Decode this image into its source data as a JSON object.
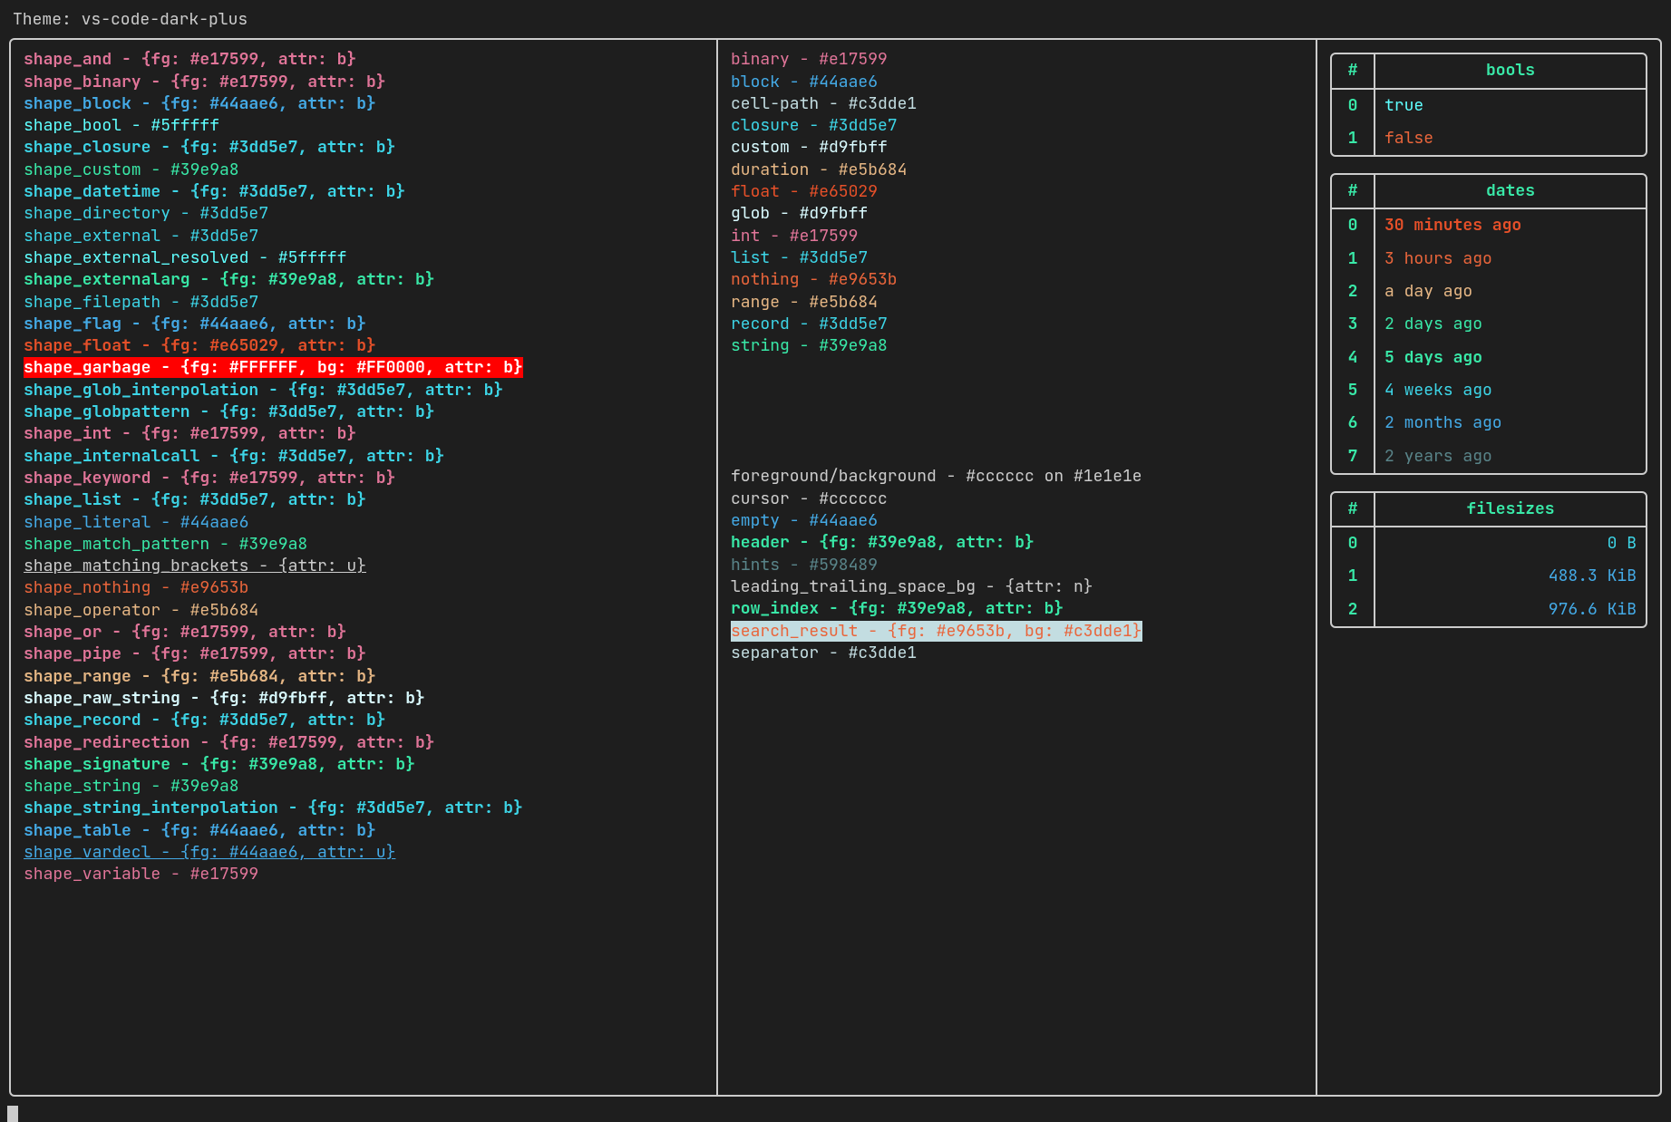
{
  "theme_label": "Theme: vs-code-dark-plus",
  "foreground": "#cccccc",
  "background": "#1e1e1e",
  "shapes": [
    {
      "name": "shape_and",
      "style": "b",
      "color": "#e17599",
      "text": "shape_and - {fg: #e17599, attr: b}"
    },
    {
      "name": "shape_binary",
      "style": "b",
      "color": "#e17599",
      "text": "shape_binary - {fg: #e17599, attr: b}"
    },
    {
      "name": "shape_block",
      "style": "b",
      "color": "#44aae6",
      "text": "shape_block - {fg: #44aae6, attr: b}"
    },
    {
      "name": "shape_bool",
      "style": "",
      "color": "#5fffff",
      "text": "shape_bool - #5fffff"
    },
    {
      "name": "shape_closure",
      "style": "b",
      "color": "#3dd5e7",
      "text": "shape_closure - {fg: #3dd5e7, attr: b}"
    },
    {
      "name": "shape_custom",
      "style": "",
      "color": "#39e9a8",
      "text": "shape_custom - #39e9a8"
    },
    {
      "name": "shape_datetime",
      "style": "b",
      "color": "#3dd5e7",
      "text": "shape_datetime - {fg: #3dd5e7, attr: b}"
    },
    {
      "name": "shape_directory",
      "style": "",
      "color": "#3dd5e7",
      "text": "shape_directory - #3dd5e7"
    },
    {
      "name": "shape_external",
      "style": "",
      "color": "#3dd5e7",
      "text": "shape_external - #3dd5e7"
    },
    {
      "name": "shape_external_resolved",
      "style": "",
      "color": "#5fffff",
      "text": "shape_external_resolved - #5fffff"
    },
    {
      "name": "shape_externalarg",
      "style": "b",
      "color": "#39e9a8",
      "text": "shape_externalarg - {fg: #39e9a8, attr: b}"
    },
    {
      "name": "shape_filepath",
      "style": "",
      "color": "#3dd5e7",
      "text": "shape_filepath - #3dd5e7"
    },
    {
      "name": "shape_flag",
      "style": "b",
      "color": "#44aae6",
      "text": "shape_flag - {fg: #44aae6, attr: b}"
    },
    {
      "name": "shape_float",
      "style": "b",
      "color": "#e65029",
      "text": "shape_float - {fg: #e65029, attr: b}"
    },
    {
      "name": "shape_garbage",
      "style": "b",
      "color": "#FFFFFF",
      "bg": "#FF0000",
      "text": "shape_garbage - {fg: #FFFFFF, bg: #FF0000, attr: b}"
    },
    {
      "name": "shape_glob_interpolation",
      "style": "b",
      "color": "#3dd5e7",
      "text": "shape_glob_interpolation - {fg: #3dd5e7, attr: b}"
    },
    {
      "name": "shape_globpattern",
      "style": "b",
      "color": "#3dd5e7",
      "text": "shape_globpattern - {fg: #3dd5e7, attr: b}"
    },
    {
      "name": "shape_int",
      "style": "b",
      "color": "#e17599",
      "text": "shape_int - {fg: #e17599, attr: b}"
    },
    {
      "name": "shape_internalcall",
      "style": "b",
      "color": "#3dd5e7",
      "text": "shape_internalcall - {fg: #3dd5e7, attr: b}"
    },
    {
      "name": "shape_keyword",
      "style": "b",
      "color": "#e17599",
      "text": "shape_keyword - {fg: #e17599, attr: b}"
    },
    {
      "name": "shape_list",
      "style": "b",
      "color": "#3dd5e7",
      "text": "shape_list - {fg: #3dd5e7, attr: b}"
    },
    {
      "name": "shape_literal",
      "style": "",
      "color": "#44aae6",
      "text": "shape_literal - #44aae6"
    },
    {
      "name": "shape_match_pattern",
      "style": "",
      "color": "#39e9a8",
      "text": "shape_match_pattern - #39e9a8"
    },
    {
      "name": "shape_matching_brackets",
      "style": "u",
      "color": "#cccccc",
      "text": "shape_matching_brackets - {attr: u}"
    },
    {
      "name": "shape_nothing",
      "style": "",
      "color": "#e9653b",
      "text": "shape_nothing - #e9653b"
    },
    {
      "name": "shape_operator",
      "style": "",
      "color": "#e5b684",
      "text": "shape_operator - #e5b684"
    },
    {
      "name": "shape_or",
      "style": "b",
      "color": "#e17599",
      "text": "shape_or - {fg: #e17599, attr: b}"
    },
    {
      "name": "shape_pipe",
      "style": "b",
      "color": "#e17599",
      "text": "shape_pipe - {fg: #e17599, attr: b}"
    },
    {
      "name": "shape_range",
      "style": "b",
      "color": "#e5b684",
      "text": "shape_range - {fg: #e5b684, attr: b}"
    },
    {
      "name": "shape_raw_string",
      "style": "b",
      "color": "#d9fbff",
      "text": "shape_raw_string - {fg: #d9fbff, attr: b}"
    },
    {
      "name": "shape_record",
      "style": "b",
      "color": "#3dd5e7",
      "text": "shape_record - {fg: #3dd5e7, attr: b}"
    },
    {
      "name": "shape_redirection",
      "style": "b",
      "color": "#e17599",
      "text": "shape_redirection - {fg: #e17599, attr: b}"
    },
    {
      "name": "shape_signature",
      "style": "b",
      "color": "#39e9a8",
      "text": "shape_signature - {fg: #39e9a8, attr: b}"
    },
    {
      "name": "shape_string",
      "style": "",
      "color": "#39e9a8",
      "text": "shape_string - #39e9a8"
    },
    {
      "name": "shape_string_interpolation",
      "style": "b",
      "color": "#3dd5e7",
      "text": "shape_string_interpolation - {fg: #3dd5e7, attr: b}"
    },
    {
      "name": "shape_table",
      "style": "b",
      "color": "#44aae6",
      "text": "shape_table - {fg: #44aae6, attr: b}"
    },
    {
      "name": "shape_vardecl",
      "style": "u",
      "color": "#44aae6",
      "text": "shape_vardecl - {fg: #44aae6, attr: u}"
    },
    {
      "name": "shape_variable",
      "style": "",
      "color": "#e17599",
      "text": "shape_variable - #e17599"
    }
  ],
  "types": [
    {
      "name": "binary",
      "color": "#e17599",
      "text": "binary - #e17599"
    },
    {
      "name": "block",
      "color": "#44aae6",
      "text": "block - #44aae6"
    },
    {
      "name": "cell-path",
      "color": "#c3dde1",
      "text": "cell-path - #c3dde1"
    },
    {
      "name": "closure",
      "color": "#3dd5e7",
      "text": "closure - #3dd5e7"
    },
    {
      "name": "custom",
      "color": "#d9fbff",
      "text": "custom - #d9fbff"
    },
    {
      "name": "duration",
      "color": "#e5b684",
      "text": "duration - #e5b684"
    },
    {
      "name": "float",
      "color": "#e65029",
      "text": "float - #e65029"
    },
    {
      "name": "glob",
      "color": "#d9fbff",
      "text": "glob - #d9fbff"
    },
    {
      "name": "int",
      "color": "#e17599",
      "text": "int - #e17599"
    },
    {
      "name": "list",
      "color": "#3dd5e7",
      "text": "list - #3dd5e7"
    },
    {
      "name": "nothing",
      "color": "#e9653b",
      "text": "nothing - #e9653b"
    },
    {
      "name": "range",
      "color": "#e5b684",
      "text": "range - #e5b684"
    },
    {
      "name": "record",
      "color": "#3dd5e7",
      "text": "record - #3dd5e7"
    },
    {
      "name": "string",
      "color": "#39e9a8",
      "text": "string - #39e9a8"
    }
  ],
  "ui": [
    {
      "name": "foreground_background",
      "color": "#cccccc",
      "style": "",
      "text": "foreground/background - #cccccc on #1e1e1e"
    },
    {
      "name": "cursor",
      "color": "#cccccc",
      "style": "",
      "text": "cursor - #cccccc"
    },
    {
      "name": "empty",
      "color": "#44aae6",
      "style": "",
      "text": "empty - #44aae6"
    },
    {
      "name": "header",
      "color": "#39e9a8",
      "style": "b",
      "text": "header - {fg: #39e9a8, attr: b}"
    },
    {
      "name": "hints",
      "color": "#598489",
      "style": "",
      "text": "hints - #598489"
    },
    {
      "name": "leading_trailing_space_bg",
      "color": "#cccccc",
      "style": "",
      "text": "leading_trailing_space_bg - {attr: n}"
    },
    {
      "name": "row_index",
      "color": "#39e9a8",
      "style": "b",
      "text": "row_index - {fg: #39e9a8, attr: b}"
    },
    {
      "name": "search_result",
      "color": "#e9653b",
      "bg": "#c3dde1",
      "style": "",
      "text": "search_result - {fg: #e9653b, bg: #c3dde1}"
    },
    {
      "name": "separator",
      "color": "#c3dde1",
      "style": "",
      "text": "separator - #c3dde1"
    }
  ],
  "tables": {
    "bools": {
      "header_idx": "#",
      "header_val": "bools",
      "rows": [
        {
          "i": "0",
          "val": "true",
          "color": "#5fffff"
        },
        {
          "i": "1",
          "val": "false",
          "color": "#e9653b"
        }
      ]
    },
    "dates": {
      "header_idx": "#",
      "header_val": "dates",
      "rows": [
        {
          "i": "0",
          "val": "30 minutes ago",
          "color": "#e65029",
          "style": "b"
        },
        {
          "i": "1",
          "val": "3 hours ago",
          "color": "#e9653b"
        },
        {
          "i": "2",
          "val": "a day ago",
          "color": "#e5b684"
        },
        {
          "i": "3",
          "val": "2 days ago",
          "color": "#39e9a8"
        },
        {
          "i": "4",
          "val": "5 days ago",
          "color": "#39e9a8",
          "style": "b"
        },
        {
          "i": "5",
          "val": "4 weeks ago",
          "color": "#3dd5e7"
        },
        {
          "i": "6",
          "val": "2 months ago",
          "color": "#44aae6"
        },
        {
          "i": "7",
          "val": "2 years ago",
          "color": "#598489"
        }
      ]
    },
    "filesizes": {
      "header_idx": "#",
      "header_val": "filesizes",
      "rows": [
        {
          "i": "0",
          "val": "0 B",
          "color": "#3dd5e7"
        },
        {
          "i": "1",
          "val": "488.3 KiB",
          "color": "#44aae6"
        },
        {
          "i": "2",
          "val": "976.6 KiB",
          "color": "#44aae6"
        }
      ]
    }
  }
}
